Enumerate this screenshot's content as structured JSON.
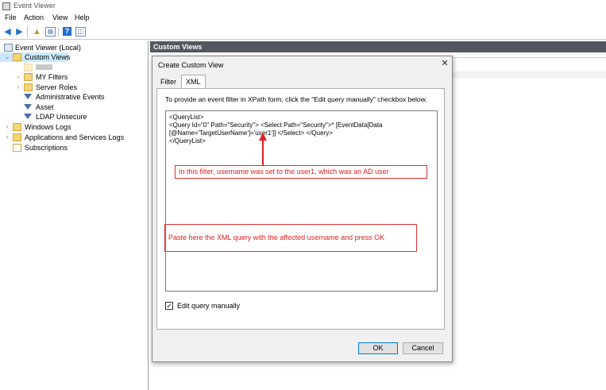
{
  "window": {
    "title": "Event Viewer"
  },
  "menu": [
    "File",
    "Action",
    "View",
    "Help"
  ],
  "toolbar": {
    "icons": [
      "back-arrow-icon",
      "forward-arrow-icon",
      "up-folder-icon",
      "properties-icon",
      "help-icon",
      "show-pane-icon"
    ]
  },
  "tree": {
    "root": "Event Viewer (Local)",
    "custom_views": "Custom Views",
    "blurred_item": "",
    "my_filters": "MY Filters",
    "server_roles": "Server Roles",
    "admin_events": "Administrative Events",
    "asset": "Asset",
    "ldap": "LDAP Unsecure",
    "windows_logs": "Windows Logs",
    "apps_logs": "Applications and Services Logs",
    "subscriptions": "Subscriptions"
  },
  "right_pane": {
    "header": "Custom Views"
  },
  "dialog": {
    "title": "Create Custom View",
    "close": "✕",
    "tabs": [
      "Filter",
      "XML"
    ],
    "instruction": "To provide an event filter in XPath form, click the \"Edit query manually\" checkbox below.",
    "xml_lines": [
      "<QueryList>",
      "<Query Id=\"0\" Path=\"Security\"> <Select Path=\"Security\">* [EventData[Data",
      "[@Name='TargetUserName']='user1']] </Select> </Query>",
      "</QueryList>"
    ],
    "note1": "In this filter, username was set to the user1, which was an AD user",
    "note2": "Paste here the XML query with the affected username and press OK",
    "checkbox_label": "Edit query manually",
    "checkbox_checked": "✓",
    "ok": "OK",
    "cancel": "Cancel"
  },
  "colors": {
    "annotation": "#e02020",
    "header_bg": "#53575f",
    "selection": "#cce8ff"
  }
}
